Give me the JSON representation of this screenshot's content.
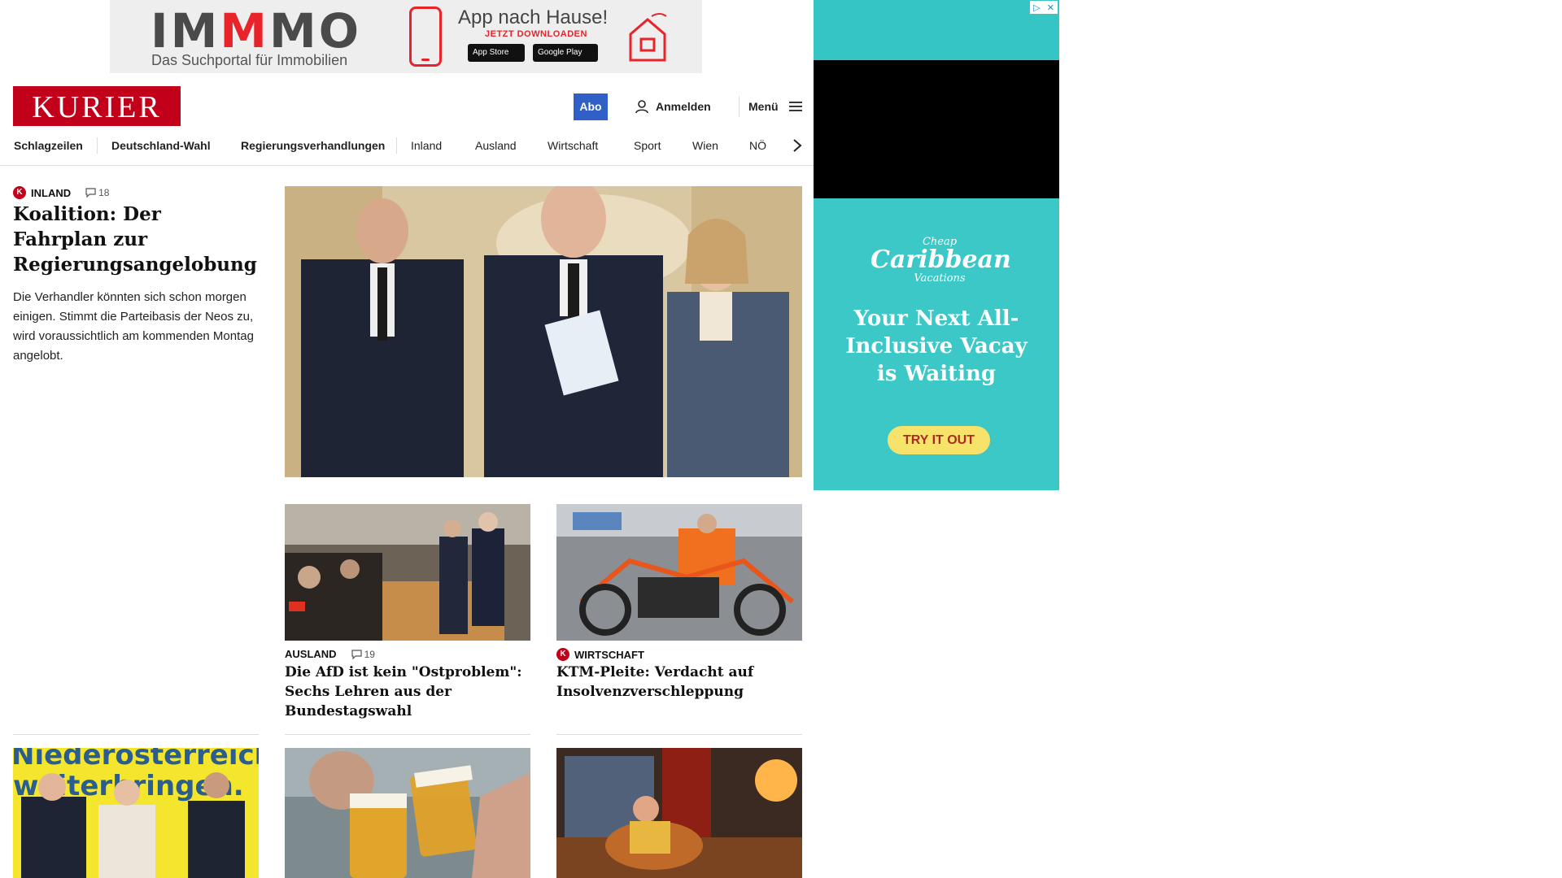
{
  "top_ad": {
    "brand_a": "IM",
    "brand_b": "M",
    "brand_c": "MO",
    "tagline": "Das Suchportal für Immobilien",
    "headline": "App nach Hause!",
    "cta": "JETZT DOWNLOADEN",
    "app_store": "App Store",
    "google_play": "Google Play"
  },
  "header": {
    "logo": "KURIER",
    "abo": "Abo",
    "login": "Anmelden",
    "menu": "Menü"
  },
  "nav": {
    "items": [
      "Schlagzeilen",
      "Deutschland-Wahl",
      "Regierungsverhandlungen",
      "Inland",
      "Ausland",
      "Wirtschaft",
      "Sport",
      "Wien",
      "NÖ"
    ]
  },
  "lead": {
    "category": "INLAND",
    "comments": "18",
    "title": "Koalition: Der Fahrplan zur Regierungsangelobung",
    "teaser": "Die Verhandler könnten sich schon morgen einigen. Stimmt die Parteibasis der Neos zu, wird voraussichtlich am kommenden Montag angelobt."
  },
  "stories": [
    {
      "category": "AUSLAND",
      "comments": "19",
      "title": "Die AfD ist kein \"Ostproblem\": Sechs Lehren aus der Bundestagswahl"
    },
    {
      "category": "WIRTSCHAFT",
      "title": "KTM-Pleite: Verdacht auf Insolvenzverschleppung"
    }
  ],
  "bottom_row": {
    "poster_text_1": "Niederösterreich",
    "poster_text_2": "weiterbringen."
  },
  "side_ad": {
    "brand_small_top": "Cheap",
    "brand_big": "Caribbean",
    "brand_small_bottom": "Vacations",
    "headline": "Your Next All-Inclusive Vacay is Waiting",
    "button": "TRY IT OUT"
  },
  "colors": {
    "brand_red": "#c20019",
    "abo_blue": "#2f5fc7",
    "ad_teal": "#3dc8c8"
  }
}
